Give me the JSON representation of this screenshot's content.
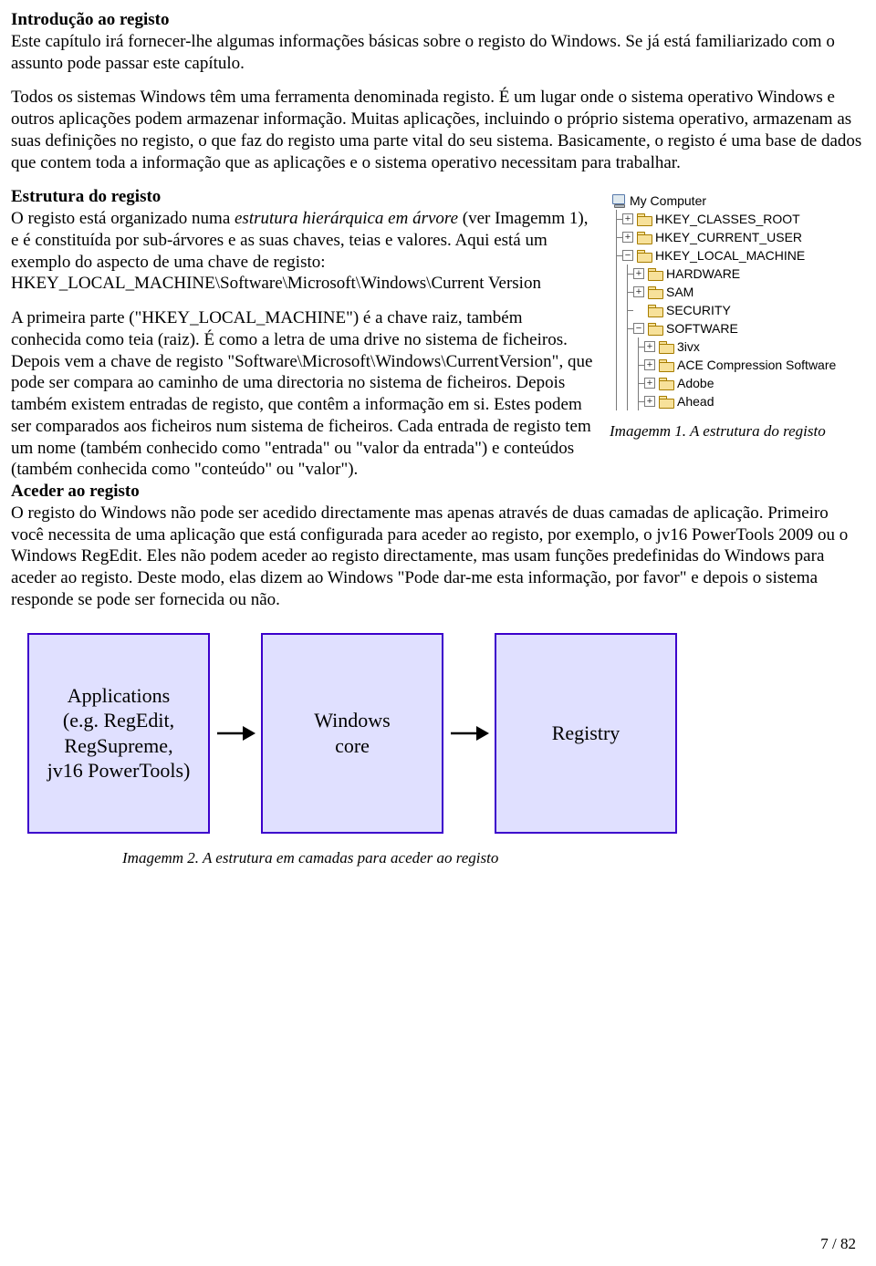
{
  "headings": {
    "intro": "Introdução ao registo",
    "structure": "Estrutura do registo",
    "access": "Aceder ao registo"
  },
  "paragraphs": {
    "intro": "Este capítulo irá fornecer-lhe algumas informações básicas sobre o registo do Windows. Se já está familiarizado com o assunto pode passar este capítulo.",
    "overview": "Todos os sistemas Windows têm uma ferramenta denominada registo. É um lugar onde o sistema operativo Windows e outros aplicações podem armazenar informação. Muitas aplicações, incluindo o próprio sistema operativo, armazenam as suas definições no registo, o que faz do registo uma parte vital do seu sistema. Basicamente, o registo é uma base de dados que contem toda a informação que as aplicações e o sistema operativo necessitam para trabalhar.",
    "structure_a": "O registo está organizado numa ",
    "structure_em": "estrutura hierárquica em árvore",
    "structure_b": " (ver Imagemm 1), e é constituída por sub-árvores e as suas chaves, teias e valores. Aqui está um exemplo do aspecto de uma chave de registo:",
    "example_key": "HKEY_LOCAL_MACHINE\\Software\\Microsoft\\Windows\\Current Version",
    "access_detail": "A primeira parte (\"HKEY_LOCAL_MACHINE\") é a chave raiz, também conhecida como teia (raiz). É como a letra de uma drive no sistema de ficheiros. Depois vem a chave de registo \"Software\\Microsoft\\Windows\\CurrentVersion\", que pode ser compara ao caminho de uma directoria no sistema de ficheiros. Depois também existem entradas de registo, que contêm a informação em si. Estes podem ser comparados aos ficheiros num sistema de ficheiros. Cada entrada de registo tem um nome (também conhecido como \"entrada\" ou \"valor da entrada\") e conteúdos (também conhecida como \"conteúdo\" ou \"valor\").",
    "access": "O registo do Windows não pode ser acedido directamente mas apenas através de duas camadas de aplicação. Primeiro você necessita de uma aplicação que está configurada para aceder ao registo, por exemplo, o jv16 PowerTools 2009 ou o Windows RegEdit. Eles não podem aceder ao registo directamente, mas usam funções predefinidas do Windows para aceder ao registo. Deste modo, elas dizem ao Windows \"Pode dar-me esta informação, por favor\" e depois o sistema responde se pode ser fornecida ou não."
  },
  "tree": {
    "root": "My Computer",
    "n0": "HKEY_CLASSES_ROOT",
    "n1": "HKEY_CURRENT_USER",
    "n2": "HKEY_LOCAL_MACHINE",
    "n2a": "HARDWARE",
    "n2b": "SAM",
    "n2c": "SECURITY",
    "n2d": "SOFTWARE",
    "n2d1": "3ivx",
    "n2d2": "ACE Compression Software",
    "n2d3": "Adobe",
    "n2d4": "Ahead"
  },
  "captions": {
    "fig1": "Imagemm 1. A estrutura do registo",
    "fig2": "Imagemm 2. A estrutura em camadas para aceder ao registo"
  },
  "diagram": {
    "box1": {
      "l1": "Applications",
      "l2": "(e.g. RegEdit,",
      "l3": "RegSupreme,",
      "l4": "jv16 PowerTools)"
    },
    "box2": {
      "l1": "Windows",
      "l2": "core"
    },
    "box3": {
      "l1": "Registry"
    }
  },
  "page": "7 / 82"
}
